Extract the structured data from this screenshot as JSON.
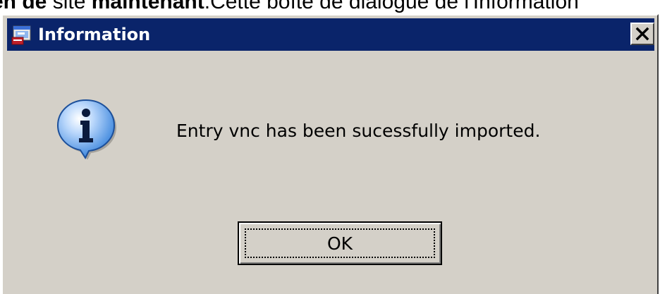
{
  "background_doc": {
    "part1": "en de",
    "part2": " site ",
    "part3": "maintenant",
    "part4": ".Cette boîte de dialogue de l'Information"
  },
  "dialog": {
    "title": "Information",
    "title_icon": "app-window-icon",
    "close_label": "✕",
    "message_icon": "information-icon",
    "message": "Entry vnc has been sucessfully imported.",
    "ok_label": "OK"
  },
  "colors": {
    "titlebar": "#0a246a",
    "dialog_face": "#d4d0c8",
    "info_bubble": "#5c9ee8"
  }
}
